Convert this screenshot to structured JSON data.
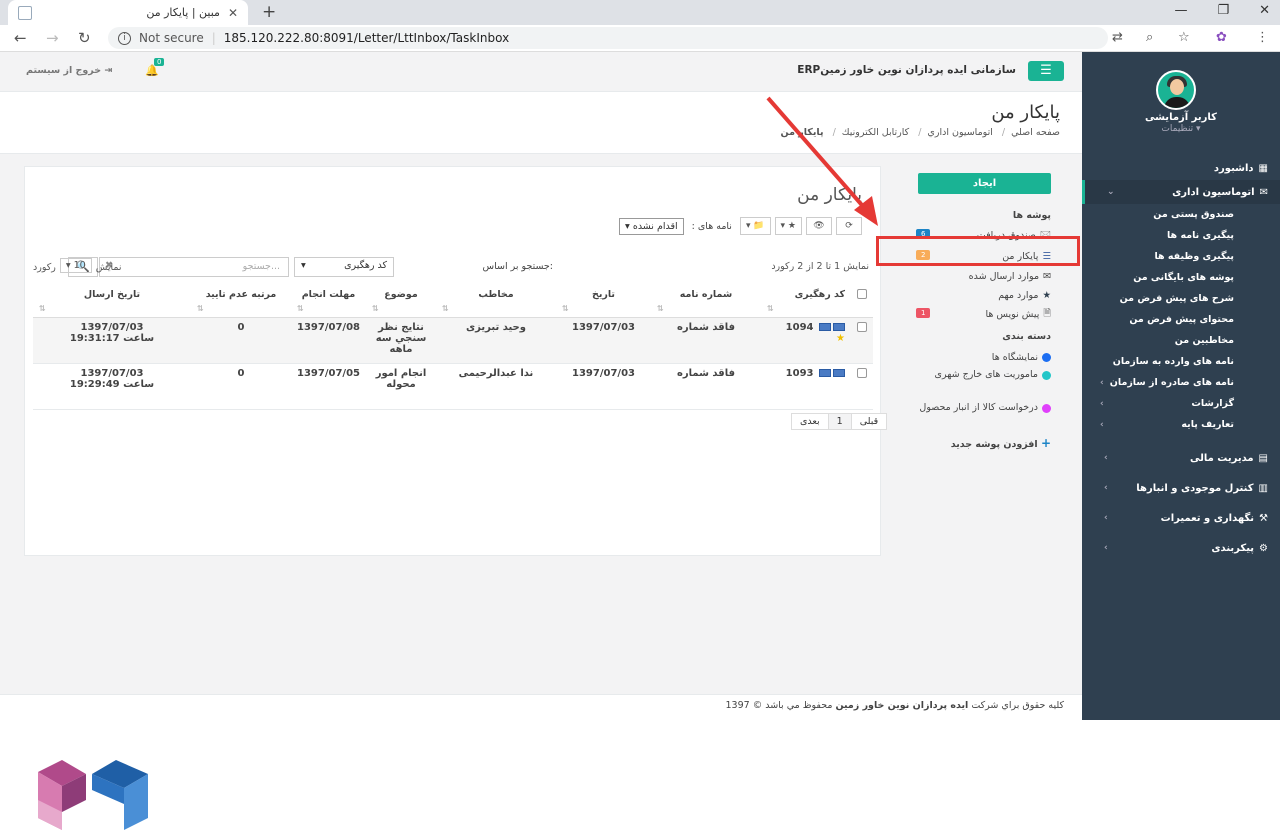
{
  "browser": {
    "tab_title": "مبين | پايكار من",
    "url_security": "Not secure",
    "url": "185.120.222.80:8091/Letter/LttInbox/TaskInbox"
  },
  "topbar": {
    "brand": "ERPسازمانی ایده پردازان نوین خاور زمین",
    "logout": "خروج از سیستم",
    "notif_count": "0"
  },
  "page": {
    "title": "پايكار من",
    "breadcrumbs": [
      "صفحه اصلي",
      "اتوماسيون اداري",
      "كارتابل الكترونيك",
      "پايكار من"
    ]
  },
  "user": {
    "name": "کاربر آزمایشی",
    "settings": "تنظیمات"
  },
  "sidebar": {
    "items": [
      {
        "label": "داشبورد"
      },
      {
        "label": "اتوماسیون اداری"
      }
    ],
    "sub": [
      {
        "label": "صندوق پستی من"
      },
      {
        "label": "پیگیری نامه ها"
      },
      {
        "label": "پیگیری وظیفه ها"
      },
      {
        "label": "پوشه های بایگانی من"
      },
      {
        "label": "شرح های پیش فرض من"
      },
      {
        "label": "محتوای پیش فرض من"
      },
      {
        "label": "مخاطبین من"
      },
      {
        "label": "نامه های وارده به سازمان"
      },
      {
        "label": "نامه های صادره از سازمان"
      },
      {
        "label": "گزارشات"
      },
      {
        "label": "تعاریف پایه"
      }
    ],
    "bottom": [
      {
        "label": "مدیریت مالی"
      },
      {
        "label": "کنترل موجودی و انبارها"
      },
      {
        "label": "نگهداری و تعمیرات"
      },
      {
        "label": "پیکربندی"
      }
    ]
  },
  "mailbox": {
    "create": "ایجاد",
    "folders_heading": "پوشه ها",
    "folders": [
      {
        "label": "صندوق دريافت",
        "badge": "6",
        "color": "#1c84c6"
      },
      {
        "label": "پايكار من",
        "badge": "2",
        "color": "#f8ac59"
      },
      {
        "label": "موارد ارسال شده",
        "badge": "",
        "color": ""
      },
      {
        "label": "موارد مهم",
        "badge": "",
        "color": ""
      },
      {
        "label": "پیش نویس ها",
        "badge": "1",
        "color": "#ed5565"
      }
    ],
    "categories_heading": "دسته بندی",
    "categories": [
      {
        "label": "نمایشگاه ها",
        "color": "#1c6ef2"
      },
      {
        "label": "ماموریت های خارج شهری",
        "color": "#23c6c8"
      },
      {
        "label": "درخواست کالا از انبار محصول",
        "color": "#e040fb"
      }
    ],
    "add_folder": "افزودن پوشه جدید"
  },
  "list": {
    "title": "پايكار من",
    "letters_label": "نامه های :",
    "letters_filter": "اقدام نشده",
    "count_text": "نمایش 1 تا 2 از 2 رکورد",
    "search_by_label": "جستجو بر اساس:",
    "search_by_value": "کد رهگیری",
    "search_placeholder": "جستجو...",
    "show_label": "نمایش",
    "per_page": "10",
    "records_label": "رکورد",
    "columns": [
      "کد رهگیری",
      "شماره نامه",
      "تاریخ",
      "مخاطب",
      "موضوع",
      "مهلت انجام",
      "مرتبه عدم تایید",
      "تاریخ ارسال"
    ],
    "rows": [
      {
        "code": "1094",
        "number": "فاقد شماره",
        "date": "1397/07/03",
        "contact": "وحید تبریزی",
        "subject": "نتايج نظر سنجي سه ماهه",
        "deadline": "1397/07/08",
        "rejects": "0",
        "sent_date": "1397/07/03",
        "sent_time": "ساعت 19:31:17"
      },
      {
        "code": "1093",
        "number": "فاقد شماره",
        "date": "1397/07/03",
        "contact": "ندا عبدالرحیمی",
        "subject": "انجام امور محوله",
        "deadline": "1397/07/05",
        "rejects": "0",
        "sent_date": "1397/07/03",
        "sent_time": "ساعت 19:29:49"
      }
    ],
    "pager": {
      "prev": "قبلی",
      "page": "1",
      "next": "بعدی"
    }
  },
  "footer": {
    "prefix": "كليه حقوق براي شركت",
    "company": "ايده پردازان نوين خاور زمين",
    "suffix": "محفوظ مي باشد © 1397"
  }
}
